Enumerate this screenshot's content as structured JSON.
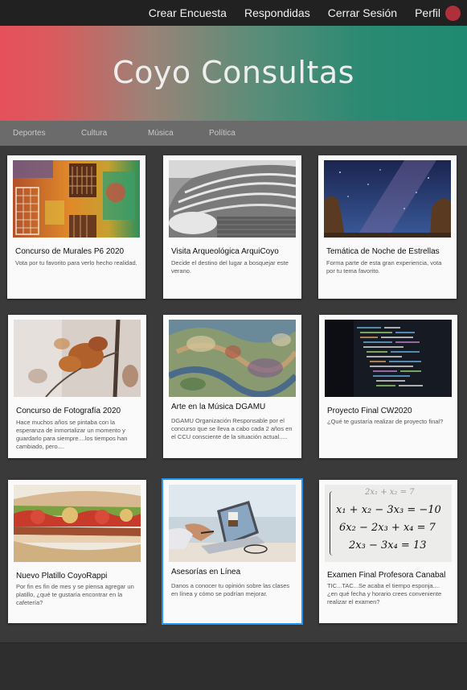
{
  "nav": {
    "create": "Crear Encuesta",
    "answered": "Respondidas",
    "logout": "Cerrar Sesión",
    "profile": "Perfil"
  },
  "hero": {
    "title": "Coyo Consultas"
  },
  "categories": [
    "Deportes",
    "Cultura",
    "Música",
    "Política"
  ],
  "cards": [
    {
      "title": "Concurso de Murales P6 2020",
      "desc": "Vota por tu favorito para verlo hecho realidad.",
      "image": "mural-image"
    },
    {
      "title": "Visita Arqueológica ArquiCoyo",
      "desc": "Decide el destino del lugar a bosquejar este verano.",
      "image": "amphitheater-image"
    },
    {
      "title": "Temática de Noche de Estrellas",
      "desc": "Forma parte de esta gran experiencia, vota por tu tema favorito.",
      "image": "night-sky-image"
    },
    {
      "title": "Concurso de Fotografía 2020",
      "desc": "Hace muchos años se pintaba con la esperanza de inmortalizar un momento y guardarlo para siempre....los tiempos han cambiado, pero....",
      "image": "autumn-leaves-image"
    },
    {
      "title": "Arte en la Música DGAMU",
      "desc": "DGAMU Organización Responsable por el concurso que se lleva a cabo cada 2 años en el CCU consciente de la situación actual.....",
      "image": "abstract-art-image"
    },
    {
      "title": "Proyecto Final CW2020",
      "desc": "¿Qué te gustaría realizar de proyecto final?",
      "image": "code-screen-image"
    },
    {
      "title": "Nuevo Platillo CoyoRappi",
      "desc": "Por fin es fin de mes y se piensa agregar un platillo, ¿qué te gustaría encontrar en la cafetería?",
      "image": "sandwich-image"
    },
    {
      "title": "Asesorías en Línea",
      "desc": "Danos a conocer tu opinión sobre las clases en línea y cómo se podrían mejorar.",
      "image": "laptop-image"
    },
    {
      "title": "Examen Final Profesora Canabal",
      "desc": "TIC...TAC...Se acaba el tiempo esponja....¿en qué fecha y horario crees conveniente realizar el examen?",
      "image": "equations-image"
    }
  ],
  "equations": [
    "2x₁ + x₂ = 7",
    "x₁ + x₂ − 3x₃ = −10",
    "6x₂ − 2x₃ + x₄ = 7",
    "2x₃ − 3x₄ = 13"
  ],
  "colors": {
    "accent": "#2196f3",
    "hero_left": "#e6505a",
    "hero_right": "#1f8a71",
    "avatar": "#b0303a"
  }
}
